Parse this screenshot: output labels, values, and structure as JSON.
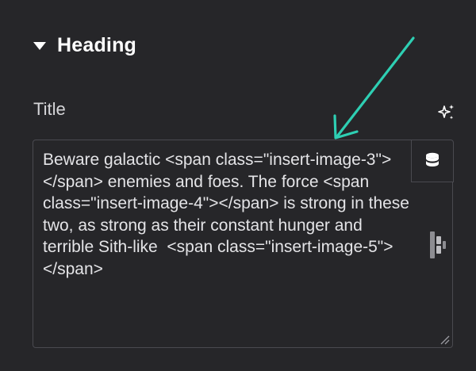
{
  "section": {
    "title": "Heading",
    "icon": "caret-down-icon"
  },
  "field": {
    "label": "Title",
    "ai_icon": "sparkle-icon",
    "value": "Beware galactic <span class=\"insert-image-3\"></span> enemies and foes. The force <span class=\"insert-image-4\"></span> is strong in these two, as strong as their constant hunger and terrible Sith-like  <span class=\"insert-image-5\"></span>",
    "dynamic_icon": "database-icon",
    "side_icon": "element-handle-icon"
  },
  "annotation": {
    "arrow_color": "#2ecfb3"
  },
  "colors": {
    "background": "#262629",
    "text": "#e4e4e7",
    "border": "#4a4a50"
  }
}
